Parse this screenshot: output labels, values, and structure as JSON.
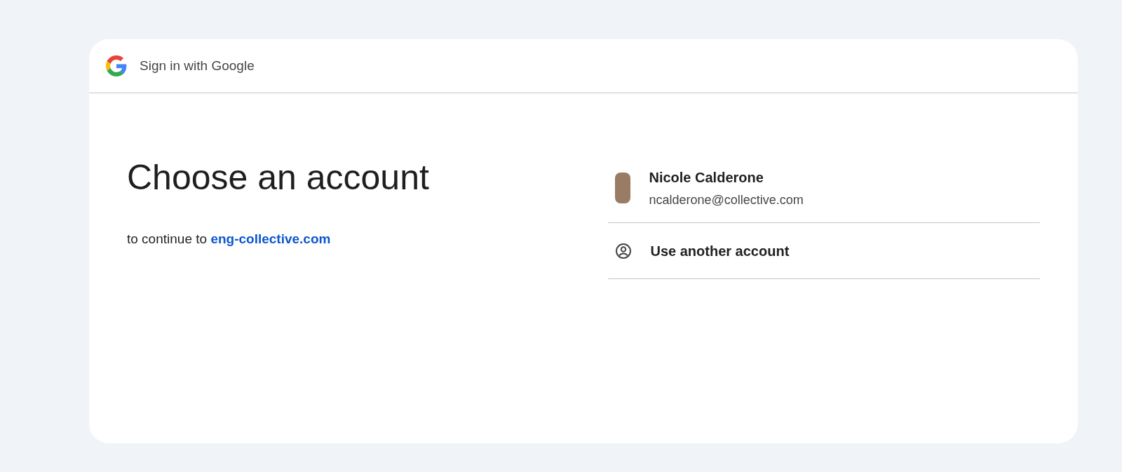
{
  "header": {
    "title": "Sign in with Google"
  },
  "heading": "Choose an account",
  "subtitle": {
    "text": "to continue to",
    "link": "eng-collective.com"
  },
  "accounts": [
    {
      "kind": "account",
      "name": "Nicole Calderone",
      "email": "ncalderone@collective.com"
    },
    {
      "kind": "other",
      "name": "Use another account"
    }
  ]
}
